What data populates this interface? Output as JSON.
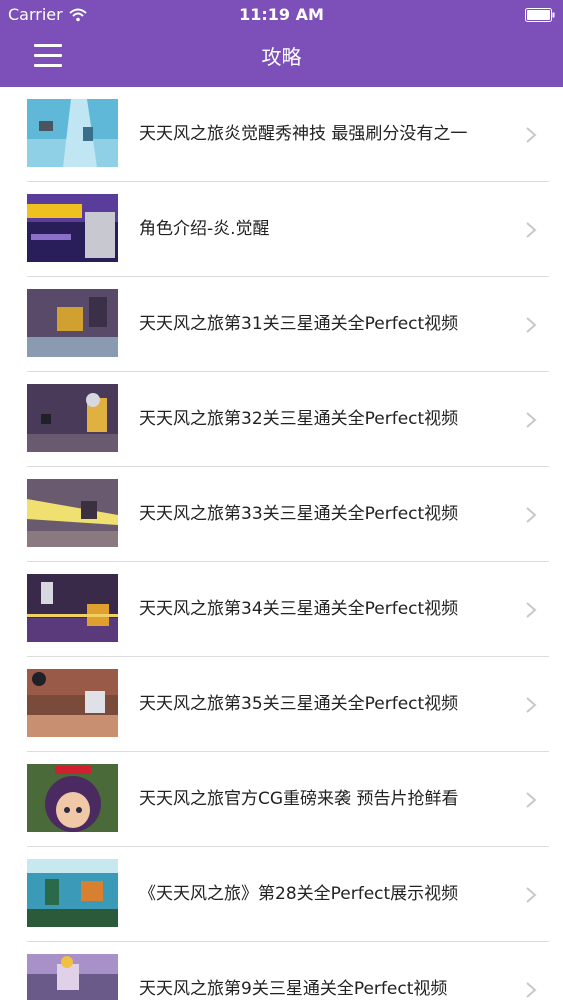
{
  "status_bar": {
    "carrier": "Carrier",
    "time": "11:19 AM"
  },
  "nav": {
    "title": "攻略",
    "menu_icon": "menu-icon"
  },
  "colors": {
    "header": "#7d4fb8",
    "divider": "#dcdcdc",
    "text": "#222222",
    "chevron": "#c7c7cc"
  },
  "items": [
    {
      "title": "天天风之旅炎觉醒秀神技 最强刷分没有之一"
    },
    {
      "title": "角色介绍-炎.觉醒"
    },
    {
      "title": "天天风之旅第31关三星通关全Perfect视频"
    },
    {
      "title": "天天风之旅第32关三星通关全Perfect视频"
    },
    {
      "title": "天天风之旅第33关三星通关全Perfect视频"
    },
    {
      "title": "天天风之旅第34关三星通关全Perfect视频"
    },
    {
      "title": "天天风之旅第35关三星通关全Perfect视频"
    },
    {
      "title": "天天风之旅官方CG重磅来袭 预告片抢鲜看"
    },
    {
      "title": "《天天风之旅》第28关全Perfect展示视频"
    },
    {
      "title": "天天风之旅第9关三星通关全Perfect视频"
    }
  ]
}
